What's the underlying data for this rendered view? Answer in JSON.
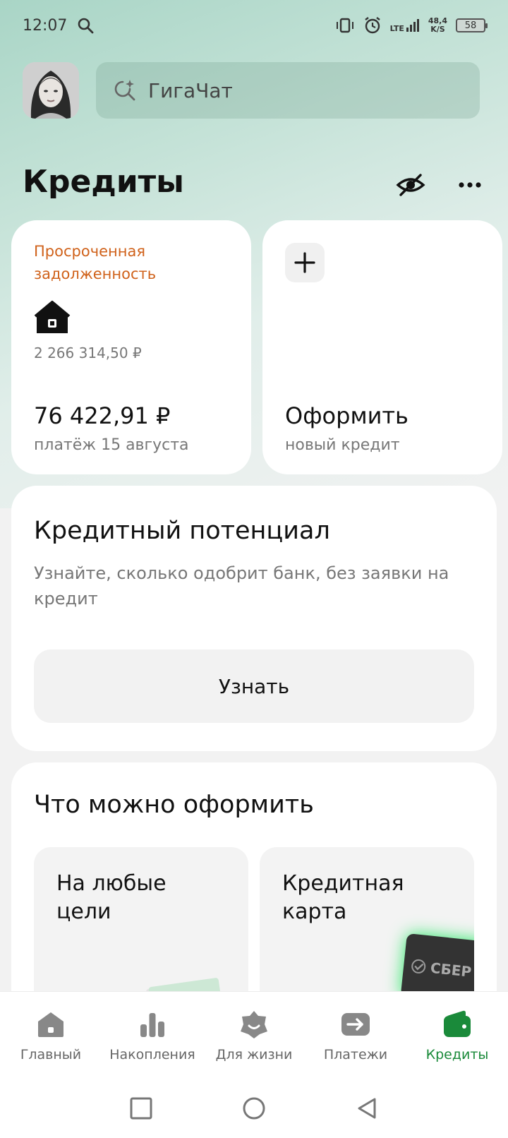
{
  "status_bar": {
    "time": "12:07",
    "network": "LTE",
    "speed_value": "48,4",
    "speed_unit": "K/S",
    "battery": "58"
  },
  "header": {
    "search_label": "ГигаЧат",
    "page_title": "Кредиты"
  },
  "loan_card": {
    "status_label": "Просроченная задолженность",
    "total_amount": "2 266 314,50 ₽",
    "payment_amount": "76 422,91 ₽",
    "payment_date": "платёж 15 августа"
  },
  "new_credit_card": {
    "title": "Оформить",
    "subtitle": "новый кредит"
  },
  "credit_potential": {
    "title": "Кредитный потенциал",
    "description": "Узнайте, сколько одобрит банк, без заявки на кредит",
    "button_label": "Узнать"
  },
  "offers": {
    "title": "Что можно оформить",
    "items": [
      {
        "label": "На любые цели"
      },
      {
        "label": "Кредитная карта",
        "card_brand": "СБЕР"
      }
    ]
  },
  "bottom_nav": {
    "items": [
      {
        "label": "Главный",
        "icon": "home-icon"
      },
      {
        "label": "Накопления",
        "icon": "bar-chart-icon"
      },
      {
        "label": "Для жизни",
        "icon": "smile-star-icon"
      },
      {
        "label": "Платежи",
        "icon": "arrow-right-icon"
      },
      {
        "label": "Кредиты",
        "icon": "wallet-icon",
        "active": true
      }
    ]
  },
  "colors": {
    "accent_green": "#1a8a3a",
    "overdue_orange": "#d0621b",
    "header_gradient": "#a9d5c6"
  }
}
